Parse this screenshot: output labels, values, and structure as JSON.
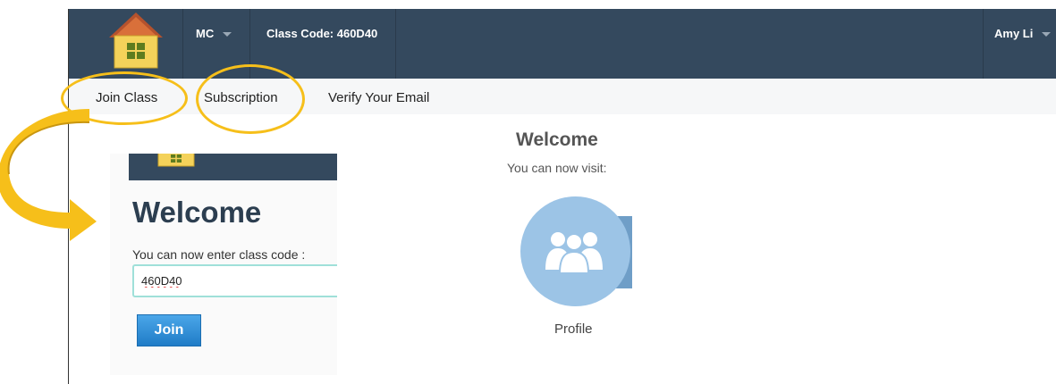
{
  "header": {
    "menu_label": "MC",
    "class_code_label": "Class Code: 460D40",
    "user_name": "Amy Li"
  },
  "subnav": {
    "items": [
      "Join Class",
      "Subscription",
      "Verify Your Email"
    ]
  },
  "welcome": {
    "title": "Welcome",
    "subtitle": "You can now visit:",
    "profile_label": "Profile"
  },
  "inset": {
    "title": "Welcome",
    "prompt": "You can now enter class code :",
    "class_code_value": "460D40",
    "join_label": "Join"
  },
  "colors": {
    "topbar": "#34495e",
    "highlight": "#f6bf1a",
    "profile": "#9cc4e6",
    "join_button": "#2b8bd8"
  },
  "icons": [
    "home-icon",
    "dropdown-caret-icon",
    "users-icon",
    "curved-arrow-icon"
  ]
}
